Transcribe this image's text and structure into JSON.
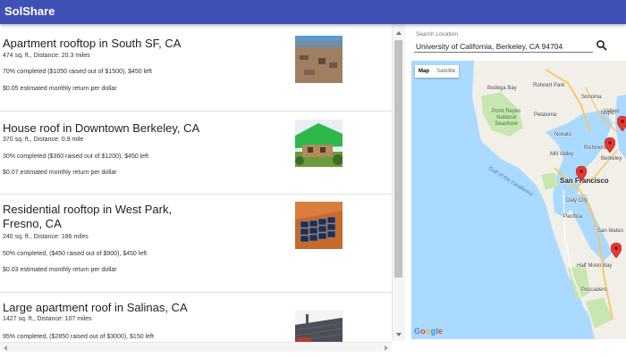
{
  "app": {
    "title": "SolShare"
  },
  "listings": [
    {
      "title": "Apartment rooftop in South SF, CA",
      "details": "474 sq. ft., Distance: 20.3 miles",
      "progress": "70% completed ($1050 raised out of $1500), $450 left",
      "return": "$0.05 estimated monthly return per dollar"
    },
    {
      "title": "House roof in Downtown Berkeley, CA",
      "details": "370 sq. ft., Distance: 0.9 mile",
      "progress": "30% completed ($360 raised out of $1200), $450 left",
      "return": "$0.07 estimated monthly return per dollar"
    },
    {
      "title": "Residential rooftop in West Park, Fresno, CA",
      "details": "240 sq. ft., Distance: 186 miles",
      "progress": "50% completed, ($450 raised out of $900), $450 left",
      "return": "$0.03 estimated monthly return per dollar"
    },
    {
      "title": "Large apartment roof in Salinas, CA",
      "details": "1427 sq. ft., Distance: 107 miles",
      "progress": "95% completed, ($2850 raised out of $3000), $150 left"
    }
  ],
  "search": {
    "label": "Search Location",
    "value": "University of California, Berkeley, CA 94704",
    "icon": "search-icon"
  },
  "map": {
    "toggle": {
      "map": "Map",
      "satellite": "Satellite",
      "selected": "Map"
    },
    "labels": {
      "bodega_bay": "Bodega Bay",
      "rohnert_park": "Rohnert Park",
      "sonoma": "Sonoma",
      "petaluma": "Petaluma",
      "novato": "Novato",
      "napa": "Napa",
      "vallejo": "Vallejo",
      "point_reyes": "Point Reyes\nNational\nSeashore",
      "richmond": "Richmond",
      "berkeley": "Berkeley",
      "mill_valley": "Mill Valley",
      "san_francisco": "San Francisco",
      "gulf": "Gulf of the Farallones",
      "daly_city": "Daly City",
      "pacifica": "Pacifica",
      "san_mateo": "San Mateo",
      "half_moon_bay": "Half Moon Bay",
      "pescadero": "Pescadero"
    },
    "google_letters": [
      "G",
      "o",
      "o",
      "g",
      "l",
      "e"
    ],
    "colors": {
      "water": "#aadaff",
      "land": "#f2efe9",
      "park": "#c8e6b0",
      "pin": "#e53935",
      "road": "#f9c55a"
    }
  },
  "colors": {
    "appbar": "#3f51b5"
  }
}
